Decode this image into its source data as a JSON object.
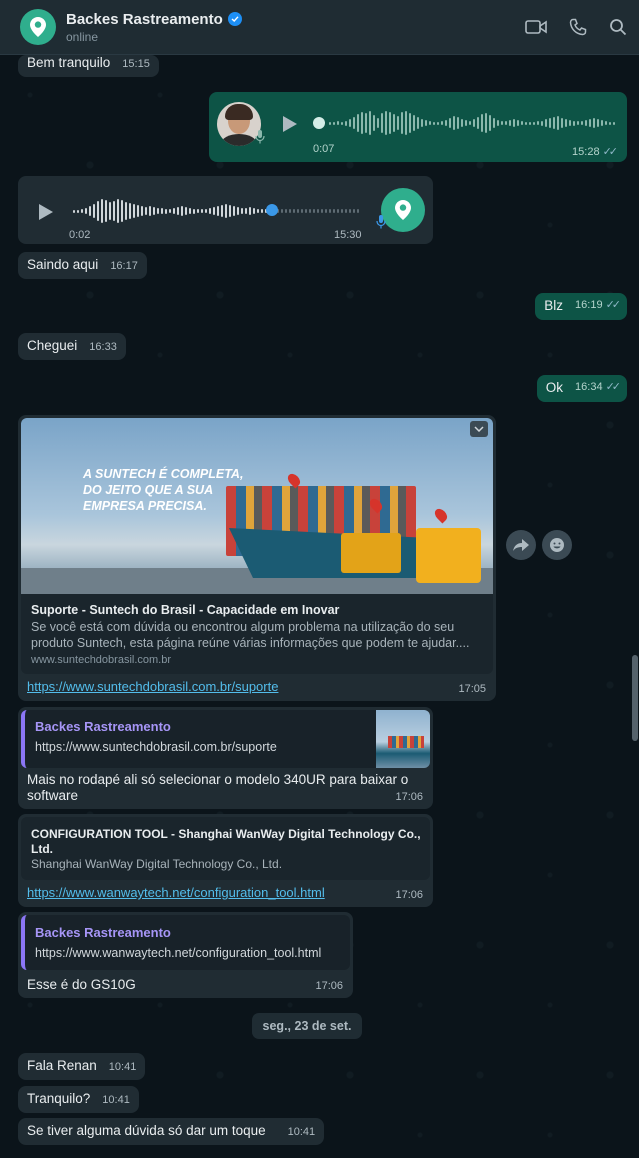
{
  "header": {
    "title": "Backes Rastreamento",
    "status": "online"
  },
  "messages": {
    "m1": {
      "text": "Bem tranquilo",
      "time": "15:15"
    },
    "voice_out": {
      "duration": "0:07",
      "time": "15:28"
    },
    "voice_in": {
      "duration": "0:02",
      "time": "15:30"
    },
    "m2": {
      "text": "Saindo aqui",
      "time": "16:17"
    },
    "m3": {
      "text": "Blz",
      "time": "16:19"
    },
    "m4": {
      "text": "Cheguei",
      "time": "16:33"
    },
    "m5": {
      "text": "Ok",
      "time": "16:34"
    },
    "link1": {
      "banner_text": "A SUNTECH É COMPLETA,\nDO JEITO QUE A SUA\nEMPRESA PRECISA.",
      "title": "Suporte - Suntech do Brasil - Capacidade em Inovar",
      "description": "Se você está com dúvida ou encontrou algum problema na utilização do seu produto Suntech, esta página reúne várias informações que podem te ajudar....",
      "domain": "www.suntechdobrasil.com.br",
      "url": "https://www.suntechdobrasil.com.br/suporte",
      "time": "17:05"
    },
    "reply1": {
      "quote_name": "Backes Rastreamento",
      "quote_text": "https://www.suntechdobrasil.com.br/suporte",
      "text": "Mais no rodapé ali só selecionar o modelo 340UR para baixar o software",
      "time": "17:06"
    },
    "link2": {
      "title": "CONFIGURATION TOOL - Shanghai WanWay Digital Technology Co., Ltd.",
      "description": "Shanghai WanWay Digital Technology Co., Ltd.",
      "url": "https://www.wanwaytech.net/configuration_tool.html",
      "time": "17:06"
    },
    "reply2": {
      "quote_name": "Backes Rastreamento",
      "quote_text": "https://www.wanwaytech.net/configuration_tool.html",
      "text": "Esse é do GS10G",
      "time": "17:06"
    },
    "day_divider": "seg., 23 de set.",
    "m6": {
      "text": "Fala Renan",
      "time": "10:41"
    },
    "m7": {
      "text": "Tranquilo?",
      "time": "10:41"
    },
    "m8": {
      "text": "Se tiver alguma dúvida só dar um toque",
      "time": "10:41"
    }
  },
  "colors": {
    "background": "#0b141a",
    "incoming": "#202c33",
    "outgoing": "#0d5446",
    "link": "#53bdeb",
    "accent": "#2fae8d"
  },
  "icons": [
    "location-pin-icon",
    "verified-icon",
    "video-call-icon",
    "phone-icon",
    "search-icon",
    "play-icon",
    "mic-icon",
    "double-check-icon",
    "chevron-down-icon",
    "forward-icon",
    "emoji-icon"
  ]
}
